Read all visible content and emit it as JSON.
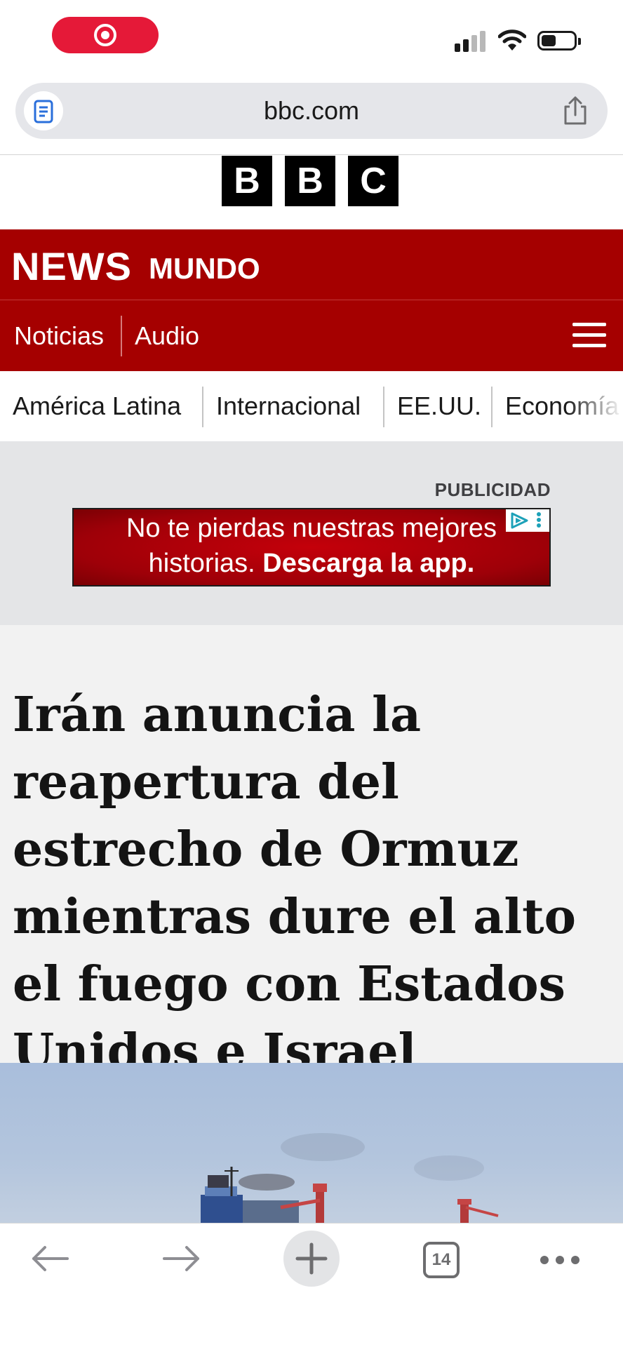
{
  "browser": {
    "url": "bbc.com",
    "tab_count": "14"
  },
  "site": {
    "logo_letters": [
      "B",
      "B",
      "C"
    ],
    "brand_news": "NEWS",
    "brand_mundo": "MUNDO",
    "nav": [
      "Noticias",
      "Audio"
    ],
    "sections": [
      "América Latina",
      "Internacional",
      "EE.UU.",
      "Economía"
    ]
  },
  "ad": {
    "label": "PUBLICIDAD",
    "line1": "No te pierdas nuestras mejores",
    "line2_normal": "historias.",
    "line2_bold": "Descarga la app."
  },
  "article": {
    "headline": "Irán anuncia la reapertura del estrecho de Ormuz mientras dure el alto el fuego con Estados Unidos e Israel"
  },
  "colors": {
    "bbc_red": "#a50000",
    "record_pill": "#e51938",
    "adchoice": "#1da1b8"
  },
  "icons": [
    "record-icon",
    "signal-icon",
    "wifi-icon",
    "battery-icon",
    "reader-icon",
    "share-icon",
    "hamburger-icon",
    "back-arrow-icon",
    "forward-arrow-icon",
    "plus-icon",
    "tabs-icon",
    "more-icon",
    "adchoice-icon"
  ]
}
